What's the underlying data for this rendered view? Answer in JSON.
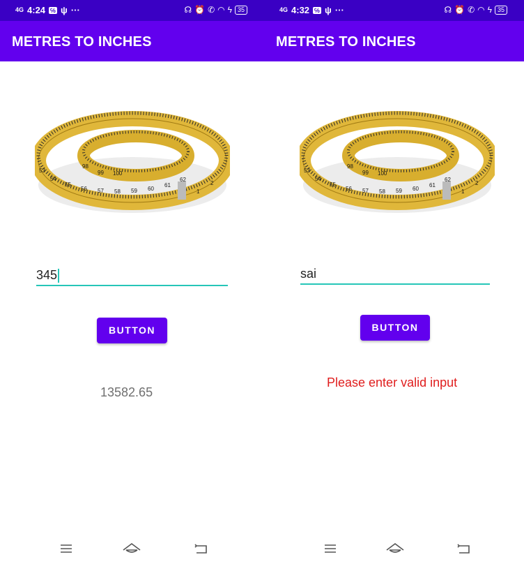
{
  "left": {
    "status": {
      "network": "4G",
      "time": "4:24",
      "battery": "35"
    },
    "app_bar": {
      "title": "METRES TO INCHES"
    },
    "input": {
      "value": "345"
    },
    "button": {
      "label": "BUTTON"
    },
    "result": {
      "text": "13582.65",
      "color": "#6f6f6f"
    }
  },
  "right": {
    "status": {
      "network": "4G",
      "time": "4:32",
      "battery": "35"
    },
    "app_bar": {
      "title": "METRES TO INCHES"
    },
    "input": {
      "value": "sai"
    },
    "button": {
      "label": "BUTTON"
    },
    "result": {
      "text": "Please enter valid input",
      "color": "#e01e1e"
    }
  },
  "tape_numbers": [
    "98",
    "99",
    "100",
    "53",
    "54",
    "55",
    "56",
    "57",
    "58",
    "59",
    "60",
    "61",
    "62",
    "1",
    "2"
  ],
  "colors": {
    "primary": "#6200ee",
    "status_bar": "#3a00c4",
    "accent": "#26c6b8",
    "error": "#e01e1e"
  },
  "icons": {
    "nav": [
      "menu-icon",
      "home-icon",
      "back-icon"
    ],
    "status": [
      "headphones-icon",
      "alarm-icon",
      "wifi-call-icon",
      "wifi-icon",
      "charging-icon",
      "battery-icon"
    ]
  }
}
